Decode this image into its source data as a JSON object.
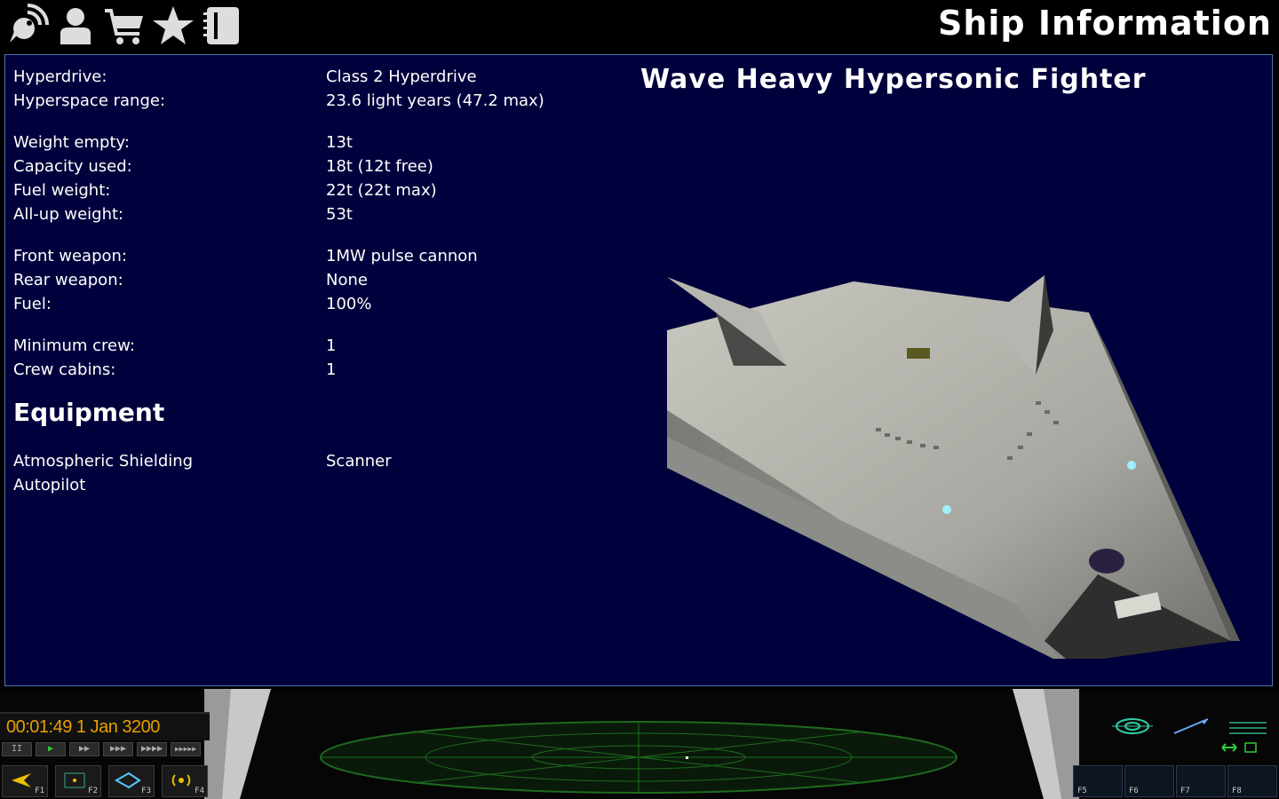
{
  "header": {
    "title": "Ship Information",
    "icons": [
      "comms-icon",
      "crew-icon",
      "shop-icon",
      "reputation-star-icon",
      "info-notebook-icon"
    ]
  },
  "ship": {
    "name": "Wave Heavy Hypersonic Fighter"
  },
  "stats": {
    "hyperdrive": {
      "label": "Hyperdrive:",
      "value": "Class 2 Hyperdrive"
    },
    "hyperspace_range": {
      "label": "Hyperspace range:",
      "value": "23.6 light years (47.2 max)"
    },
    "weight_empty": {
      "label": "Weight empty:",
      "value": "13t"
    },
    "capacity_used": {
      "label": "Capacity used:",
      "value": "18t (12t free)"
    },
    "fuel_weight": {
      "label": "Fuel weight:",
      "value": "22t (22t max)"
    },
    "all_up_weight": {
      "label": "All-up weight:",
      "value": "53t"
    },
    "front_weapon": {
      "label": "Front weapon:",
      "value": "1MW pulse cannon"
    },
    "rear_weapon": {
      "label": "Rear weapon:",
      "value": "None"
    },
    "fuel": {
      "label": "Fuel:",
      "value": "100%"
    },
    "minimum_crew": {
      "label": "Minimum crew:",
      "value": "1"
    },
    "crew_cabins": {
      "label": "Crew cabins:",
      "value": "1"
    }
  },
  "equipment": {
    "heading": "Equipment",
    "items": [
      "Atmospheric Shielding",
      "Scanner",
      "Autopilot"
    ]
  },
  "console": {
    "clock": "00:01:49 1 Jan 3200",
    "speed_buttons": [
      "II",
      "▶",
      "▶▶",
      "▶▶▶",
      "▶▶▶▶",
      "▶▶▶▶▶"
    ],
    "left_keys": [
      "F1",
      "F2",
      "F3",
      "F4"
    ],
    "right_keys": [
      "F5",
      "F6",
      "F7",
      "F8"
    ]
  },
  "colors": {
    "panel_bg": "#00003c",
    "panel_border": "#4a78b0",
    "clock_text": "#e8a000",
    "radar_green": "#1e6a1e"
  }
}
